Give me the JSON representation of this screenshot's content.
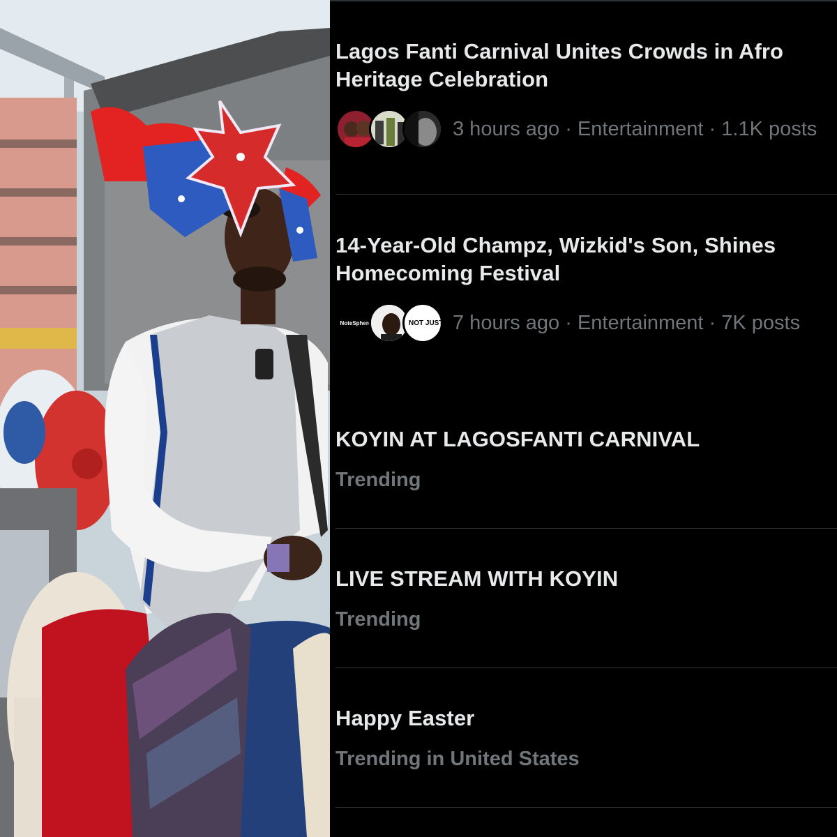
{
  "photo": {
    "description_icon": "carnival-rider-photo"
  },
  "trends": [
    {
      "title_line1": "Lagos Fanti Carnival Unites Crowds in Afro",
      "title_line2": "Heritage Celebration",
      "meta": "3 hours ago · Entertainment · 1.1K posts"
    },
    {
      "title_line1": "14-Year-Old Champz, Wizkid's Son, Shines",
      "title_line2": "Homecoming Festival",
      "meta": "7 hours ago · Entertainment · 7K posts",
      "avatar_label_1": "NoteSphere",
      "avatar_label_2": "NOT JUST OK"
    },
    {
      "title": "KOYIN AT LAGOSFANTI CARNIVAL",
      "subtitle": "Trending"
    },
    {
      "title": "LIVE STREAM WITH KOYIN",
      "subtitle": "Trending"
    },
    {
      "title": "Happy Easter",
      "subtitle": "Trending in United States"
    }
  ],
  "colors": {
    "background": "#000000",
    "title_text": "#e7e9ea",
    "secondary_text": "#71767b",
    "divider": "#2f3336"
  }
}
